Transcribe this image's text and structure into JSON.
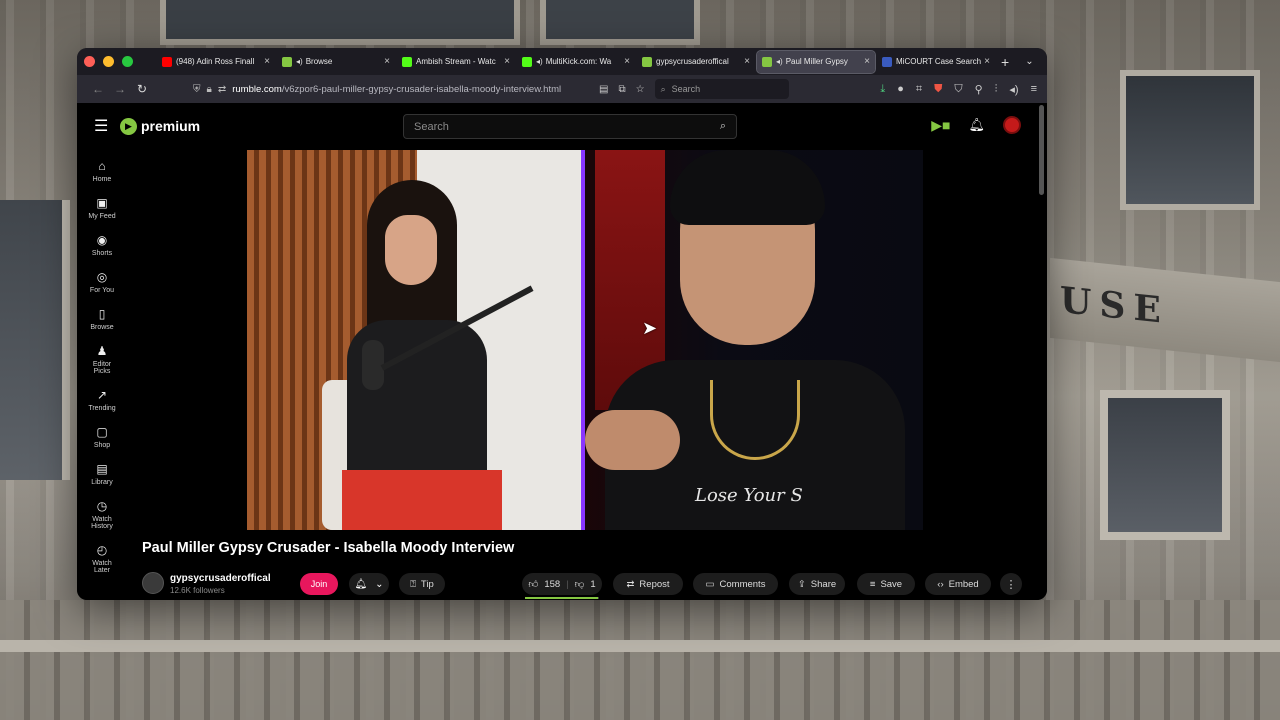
{
  "tabs": [
    {
      "label": "(948) Adin Ross Finall",
      "favicon_color": "#ff0000",
      "active": false,
      "muted": false
    },
    {
      "label": "Browse",
      "favicon_color": "#85c742",
      "active": false,
      "muted": true
    },
    {
      "label": "Ambish Stream - Watc",
      "favicon_color": "#53fc18",
      "active": false,
      "muted": false
    },
    {
      "label": "MultiKick.com: Wa",
      "favicon_color": "#53fc18",
      "active": false,
      "muted": true
    },
    {
      "label": "gypsycrusaderoffical",
      "favicon_color": "#85c742",
      "active": false,
      "muted": false
    },
    {
      "label": "Paul Miller Gypsy",
      "favicon_color": "#85c742",
      "active": true,
      "muted": true
    },
    {
      "label": "MiCOURT Case Search",
      "favicon_color": "#3a5bbf",
      "active": false,
      "muted": false
    }
  ],
  "url": {
    "domain": "rumble.com",
    "path": "/v6zpor6-paul-miller-gypsy-crusader-isabella-moody-interview.html"
  },
  "browser_search_placeholder": "Search",
  "site": {
    "logo_text": "premium",
    "search_placeholder": "Search"
  },
  "sidebar": [
    {
      "label": "Home",
      "icon": "home-icon",
      "glyph": "⌂"
    },
    {
      "label": "My Feed",
      "icon": "feed-icon",
      "glyph": "▣"
    },
    {
      "label": "Shorts",
      "icon": "shorts-icon",
      "glyph": "◉"
    },
    {
      "label": "For You",
      "icon": "for-you-icon",
      "glyph": "◎"
    },
    {
      "label": "Browse",
      "icon": "browse-icon",
      "glyph": "▯"
    },
    {
      "label": "Editor\nPicks",
      "icon": "editor-picks-icon",
      "glyph": "♟"
    },
    {
      "label": "Trending",
      "icon": "trending-icon",
      "glyph": "↗"
    },
    {
      "label": "Shop",
      "icon": "shop-icon",
      "glyph": "▢"
    },
    {
      "label": "Library",
      "icon": "library-icon",
      "glyph": "▤"
    },
    {
      "label": "Watch\nHistory",
      "icon": "watch-history-icon",
      "glyph": "◷"
    },
    {
      "label": "Watch\nLater",
      "icon": "watch-later-icon",
      "glyph": "◴"
    }
  ],
  "video": {
    "title": "Paul Miller Gypsy Crusader - Isabella Moody Interview",
    "channel": "gypsycrusaderoffical",
    "followers": "12.6K followers",
    "join_label": "Join",
    "tip_label": "Tip",
    "likes": "158",
    "dislikes": "1",
    "like_ratio": 0.99,
    "repost_label": "Repost",
    "comments_label": "Comments",
    "share_label": "Share",
    "save_label": "Save",
    "embed_label": "Embed",
    "shirt_text": "Lose Your S"
  },
  "colors": {
    "accent": "#85c742",
    "join": "#e8175d",
    "divider": "#8a35ff"
  }
}
